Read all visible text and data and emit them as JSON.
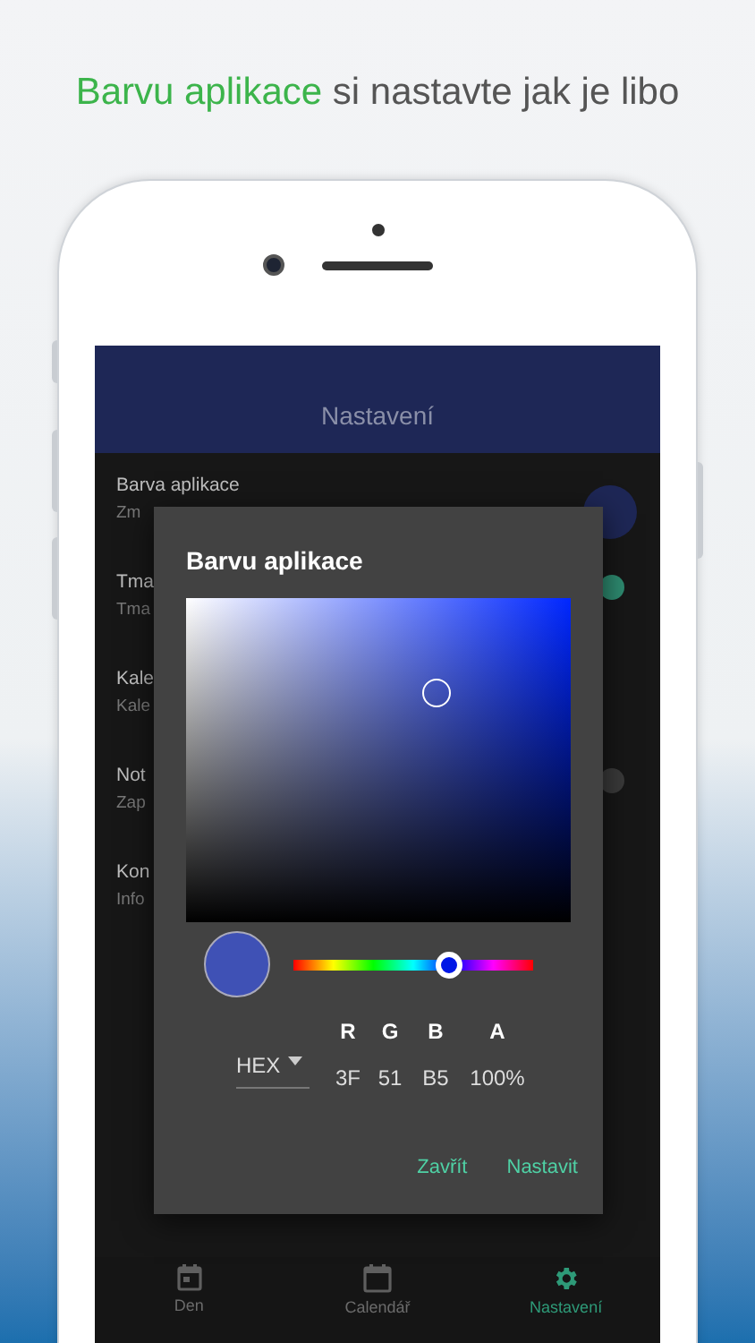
{
  "headline": {
    "highlight": "Barvu aplikace",
    "rest": "si nastavte jak je libo"
  },
  "app_bar": {
    "title": "Nastavení"
  },
  "settings": [
    {
      "kind": "color",
      "title": "Barva aplikace",
      "subtitle": "Zm"
    },
    {
      "kind": "toggle",
      "title": "Tma",
      "subtitle": "Tma",
      "on": true
    },
    {
      "kind": "plain",
      "title": "Kale",
      "subtitle": "Kale"
    },
    {
      "kind": "toggle",
      "title": "Not",
      "subtitle": "Zap",
      "on": false
    },
    {
      "kind": "plain",
      "title": "Kon",
      "subtitle": "Info"
    }
  ],
  "dialog": {
    "title": "Barvu aplikace",
    "hue_slider": {
      "level": 0.65
    },
    "format": "HEX",
    "channels": [
      {
        "label": "R",
        "value": "3F"
      },
      {
        "label": "G",
        "value": "51"
      },
      {
        "label": "B",
        "value": "B5"
      },
      {
        "label": "A",
        "value": "100%"
      }
    ],
    "buttons": [
      "Zavřít",
      "Nastavit"
    ]
  },
  "bottom_nav": [
    {
      "kind": "day",
      "label": "Den",
      "selected": false
    },
    {
      "kind": "calendar",
      "label": "Calendář",
      "selected": false
    },
    {
      "kind": "gear",
      "label": "Nastavení",
      "selected": true
    }
  ]
}
